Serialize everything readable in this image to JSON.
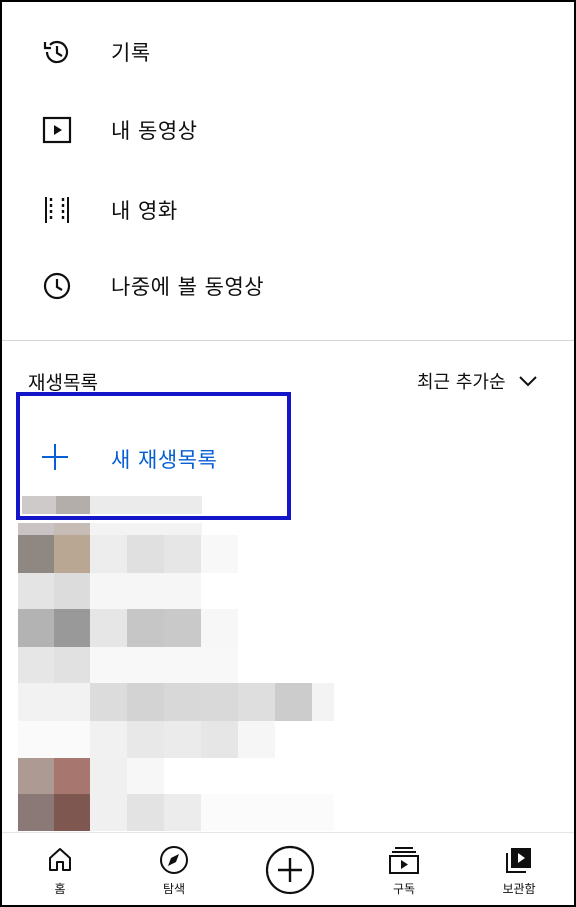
{
  "menu": {
    "items": [
      {
        "label": "기록",
        "icon": "history-icon"
      },
      {
        "label": "내 동영상",
        "icon": "play-box-icon"
      },
      {
        "label": "내 영화",
        "icon": "film-strip-icon"
      },
      {
        "label": "나중에 볼 동영상",
        "icon": "clock-icon"
      }
    ]
  },
  "playlists": {
    "section_title": "재생목록",
    "sort_label": "최근 추가순",
    "new_playlist_label": "새 재생목록"
  },
  "bottom_nav": {
    "items": [
      {
        "label": "홈",
        "icon": "home-icon"
      },
      {
        "label": "탐색",
        "icon": "explore-icon"
      },
      {
        "label": "",
        "icon": "create-icon"
      },
      {
        "label": "구독",
        "icon": "subscriptions-icon"
      },
      {
        "label": "보관함",
        "icon": "library-icon"
      }
    ]
  },
  "colors": {
    "highlight_border": "#1414c8",
    "accent": "#065fd4"
  }
}
